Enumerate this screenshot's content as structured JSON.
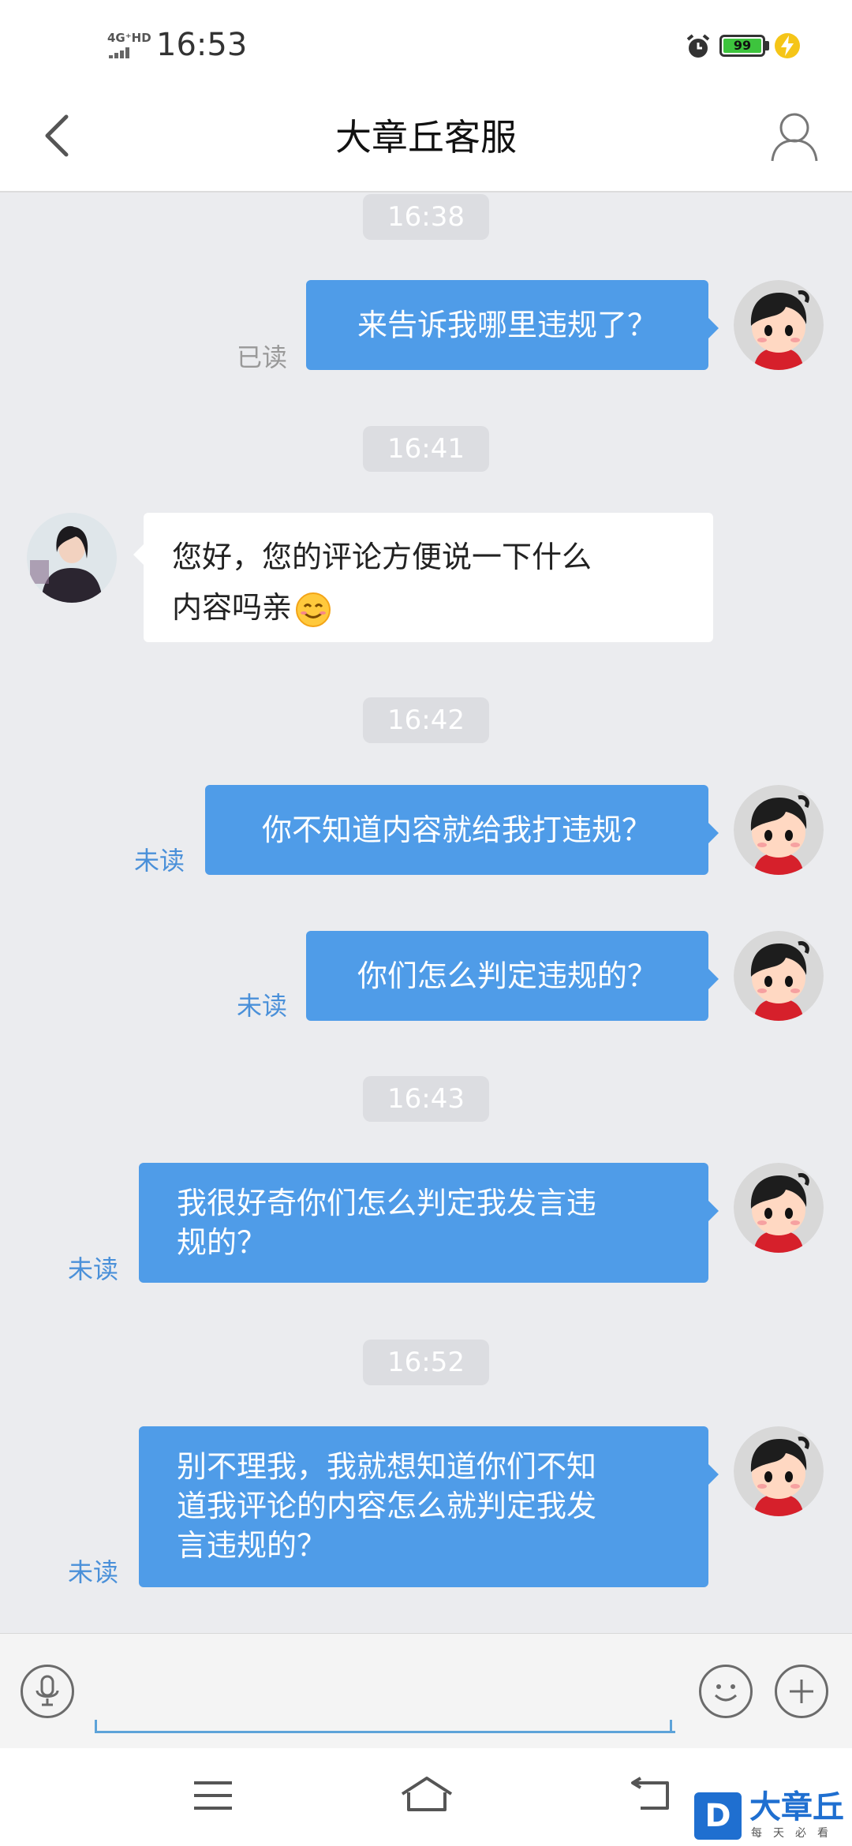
{
  "status_bar": {
    "network": "4G⁺HD",
    "time": "16:53",
    "battery": "99"
  },
  "nav": {
    "title": "大章丘客服"
  },
  "messages": [
    {
      "time": "16:38"
    },
    {
      "text": "来告诉我哪里违规了？",
      "status": "已读"
    },
    {
      "time": "16:41"
    },
    {
      "line1": "您好，您的评论方便说一下什么",
      "line2": "内容吗亲"
    },
    {
      "time": "16:42"
    },
    {
      "text": "你不知道内容就给我打违规？",
      "status": "未读"
    },
    {
      "text": "你们怎么判定违规的？",
      "status": "未读"
    },
    {
      "time": "16:43"
    },
    {
      "line1": "我很好奇你们怎么判定我发言违",
      "line2": "规的？",
      "status": "未读"
    },
    {
      "time": "16:52"
    },
    {
      "line1": "别不理我，我就想知道你们不知",
      "line2": "道我评论的内容怎么就判定我发",
      "line3": "言违规的？",
      "status": "未读"
    }
  ],
  "input": {
    "placeholder": ""
  },
  "watermark": {
    "logo_letter": "D",
    "name": "大章丘",
    "tagline": "每天必看"
  }
}
